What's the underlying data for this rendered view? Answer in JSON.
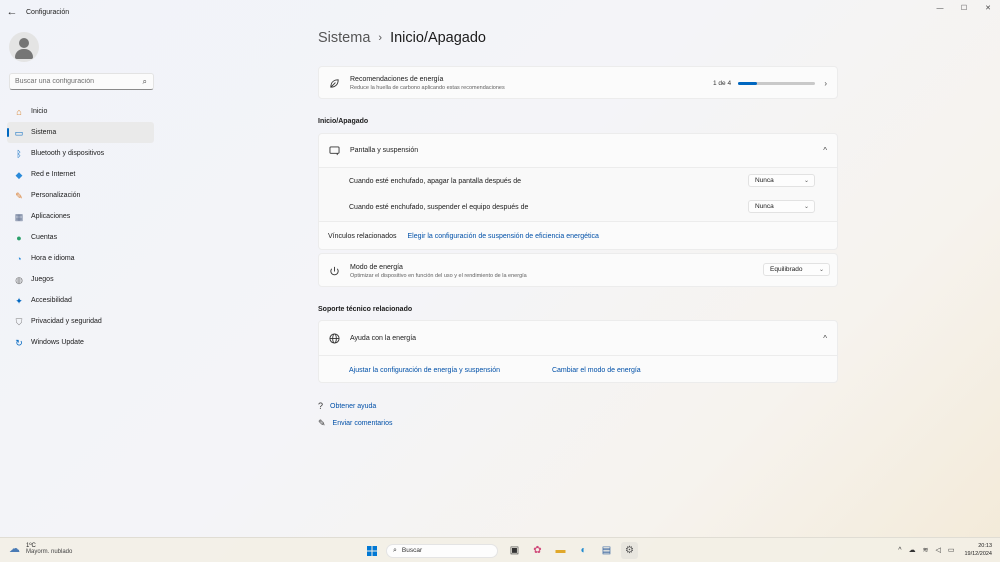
{
  "window": {
    "title": "Configuración",
    "controls": {
      "minimize": "—",
      "maximize": "☐",
      "close": "✕"
    }
  },
  "sidebar": {
    "search_placeholder": "Buscar una configuración",
    "items": [
      {
        "label": "Inicio",
        "icon": "home-icon",
        "color": "#d9822b"
      },
      {
        "label": "Sistema",
        "icon": "system-icon",
        "color": "#0067c0",
        "active": true
      },
      {
        "label": "Bluetooth y dispositivos",
        "icon": "bluetooth-icon",
        "color": "#0067c0"
      },
      {
        "label": "Red e Internet",
        "icon": "network-icon",
        "color": "#2a8ad9"
      },
      {
        "label": "Personalización",
        "icon": "brush-icon",
        "color": "#d97a2b"
      },
      {
        "label": "Aplicaciones",
        "icon": "apps-icon",
        "color": "#5a6a8a"
      },
      {
        "label": "Cuentas",
        "icon": "account-icon",
        "color": "#2aa06a"
      },
      {
        "label": "Hora e idioma",
        "icon": "globe-clock-icon",
        "color": "#2a8ad9"
      },
      {
        "label": "Juegos",
        "icon": "gamepad-icon",
        "color": "#777777"
      },
      {
        "label": "Accesibilidad",
        "icon": "accessibility-icon",
        "color": "#0067c0"
      },
      {
        "label": "Privacidad y seguridad",
        "icon": "shield-icon",
        "color": "#7a7a7a"
      },
      {
        "label": "Windows Update",
        "icon": "update-icon",
        "color": "#0067c0"
      }
    ]
  },
  "breadcrumb": {
    "parent": "Sistema",
    "separator": "›",
    "current": "Inicio/Apagado"
  },
  "recommendations": {
    "title": "Recomendaciones de energía",
    "subtitle": "Reduce la huella de carbono aplicando estas recomendaciones",
    "progress_text": "1 de 4",
    "progress_fraction": 0.25
  },
  "power_section": {
    "title": "Inicio/Apagado",
    "screen_sleep": {
      "title": "Pantalla y suspensión",
      "plugged_screen_label": "Cuando esté enchufado, apagar la pantalla después de",
      "plugged_screen_value": "Nunca",
      "plugged_sleep_label": "Cuando esté enchufado, suspender el equipo después de",
      "plugged_sleep_value": "Nunca"
    },
    "related_links": {
      "label": "Vínculos relacionados",
      "link": "Elegir la configuración de suspensión de eficiencia energética"
    },
    "power_mode": {
      "title": "Modo de energía",
      "subtitle": "Optimizar el dispositivo en función del uso y el rendimiento de la energía",
      "value": "Equilibrado"
    }
  },
  "support_section": {
    "title": "Soporte técnico relacionado",
    "help": {
      "title": "Ayuda con la energía",
      "link1": "Ajustar la configuración de energía y suspensión",
      "link2": "Cambiar el modo de energía"
    }
  },
  "footer_links": {
    "get_help": "Obtener ayuda",
    "feedback": "Enviar comentarios"
  },
  "taskbar": {
    "weather_temp": "1ºC",
    "weather_desc": "Mayorm. nublado",
    "search_label": "Buscar",
    "time": "20:13",
    "date": "19/12/2024"
  },
  "colors": {
    "accent": "#0067c0",
    "link": "#0050a8"
  }
}
